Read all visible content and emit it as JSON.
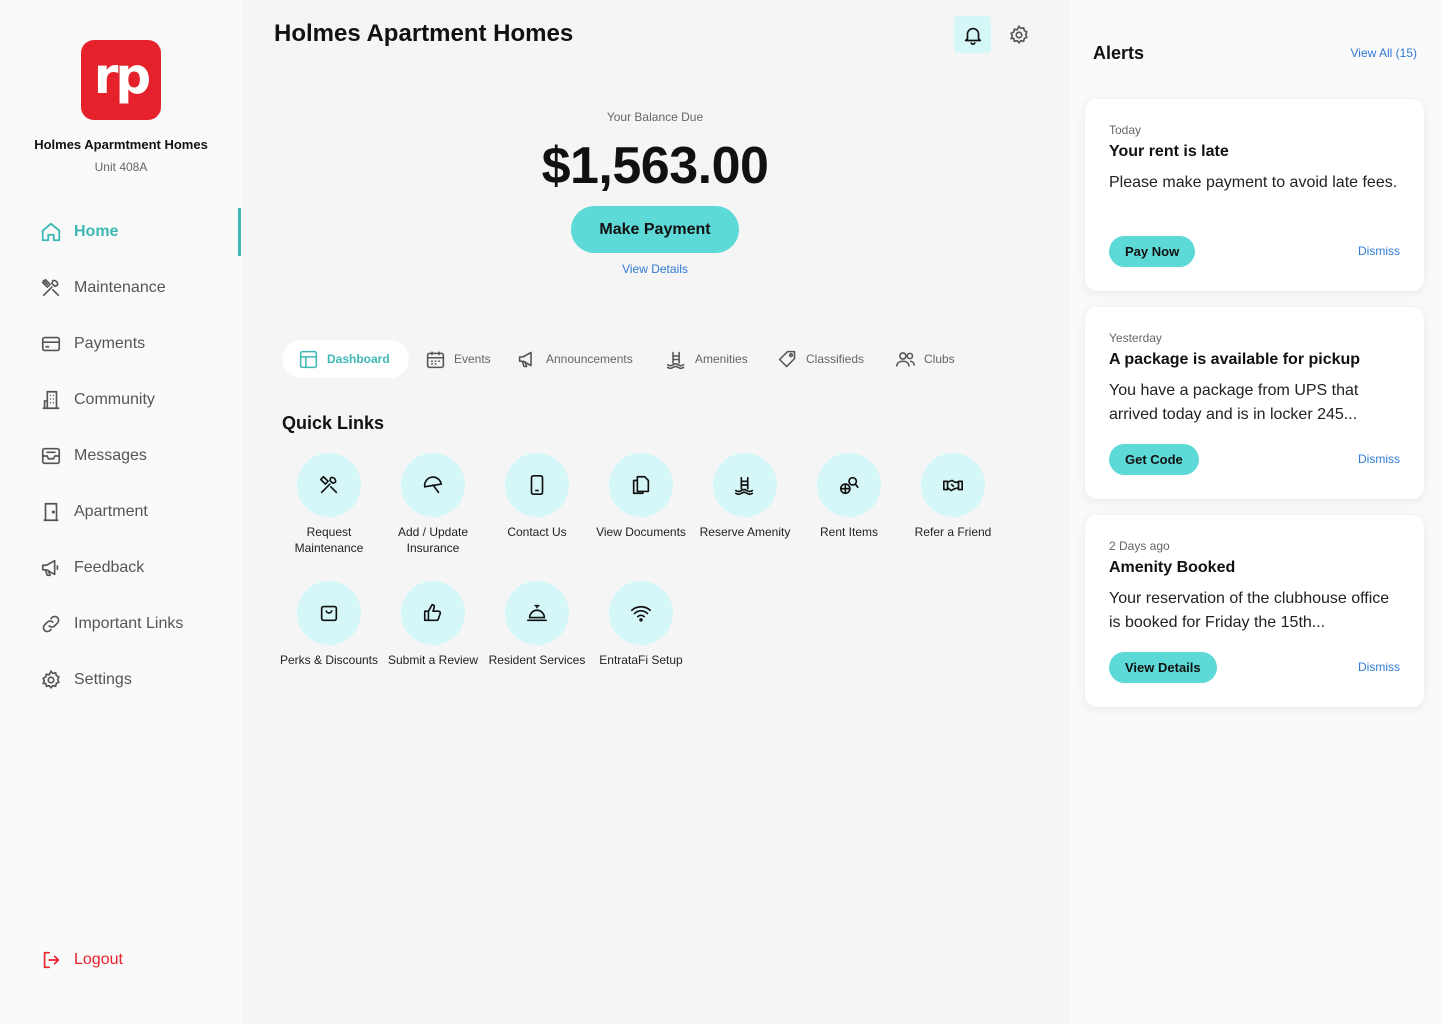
{
  "brand": {
    "logo_text": "rp",
    "color": "#e5222b",
    "property_name": "Holmes Aparmtment Homes",
    "unit": "Unit 408A"
  },
  "accent_color": "#5dd9d7",
  "sidebar": {
    "items": [
      {
        "label": "Home",
        "icon": "home-icon",
        "active": true
      },
      {
        "label": "Maintenance",
        "icon": "tools-icon"
      },
      {
        "label": "Payments",
        "icon": "credit-card-icon"
      },
      {
        "label": "Community",
        "icon": "building-icon"
      },
      {
        "label": "Messages",
        "icon": "inbox-icon"
      },
      {
        "label": "Apartment",
        "icon": "door-icon"
      },
      {
        "label": "Feedback",
        "icon": "megaphone-icon"
      },
      {
        "label": "Important Links",
        "icon": "link-icon"
      },
      {
        "label": "Settings",
        "icon": "gear-icon"
      }
    ],
    "logout_label": "Logout"
  },
  "header": {
    "title": "Holmes Apartment Homes"
  },
  "balance": {
    "label": "Your Balance Due",
    "amount": "$1,563.00",
    "pay_label": "Make Payment",
    "details_label": "View Details"
  },
  "tabs": [
    {
      "label": "Dashboard",
      "icon": "dashboard-icon",
      "active": true
    },
    {
      "label": "Events",
      "icon": "calendar-icon"
    },
    {
      "label": "Announcements",
      "icon": "megaphone-icon"
    },
    {
      "label": "Amenities",
      "icon": "pool-icon"
    },
    {
      "label": "Classifieds",
      "icon": "tag-icon"
    },
    {
      "label": "Clubs",
      "icon": "users-icon"
    }
  ],
  "quick_links": {
    "title": "Quick Links",
    "items": [
      {
        "label": "Request Maintenance",
        "icon": "tools-icon"
      },
      {
        "label": "Add / Update Insurance",
        "icon": "umbrella-icon"
      },
      {
        "label": "Contact Us",
        "icon": "phone-icon"
      },
      {
        "label": "View Documents",
        "icon": "documents-icon"
      },
      {
        "label": "Reserve Amenity",
        "icon": "pool-icon"
      },
      {
        "label": "Rent Items",
        "icon": "sports-icon"
      },
      {
        "label": "Refer a Friend",
        "icon": "handshake-icon"
      },
      {
        "label": "Perks & Discounts",
        "icon": "shopping-bag-icon"
      },
      {
        "label": "Submit a Review",
        "icon": "thumbs-up-icon"
      },
      {
        "label": "Resident Services",
        "icon": "service-bell-icon"
      },
      {
        "label": "EntrataFi Setup",
        "icon": "wifi-icon"
      }
    ]
  },
  "alerts": {
    "title": "Alerts",
    "view_all": "View All (15)",
    "items": [
      {
        "when": "Today",
        "title": "Your rent is late",
        "body": "Please make payment to avoid late fees.",
        "action": "Pay Now",
        "dismiss": "Dismiss"
      },
      {
        "when": "Yesterday",
        "title": "A package is available for pickup",
        "body": "You have a package from UPS that arrived today and is in locker 245...",
        "action": "Get Code",
        "dismiss": "Dismiss"
      },
      {
        "when": "2 Days ago",
        "title": "Amenity Booked",
        "body": "Your reservation of the clubhouse office is booked for Friday the 15th...",
        "action": "View Details",
        "dismiss": "Dismiss"
      }
    ]
  }
}
